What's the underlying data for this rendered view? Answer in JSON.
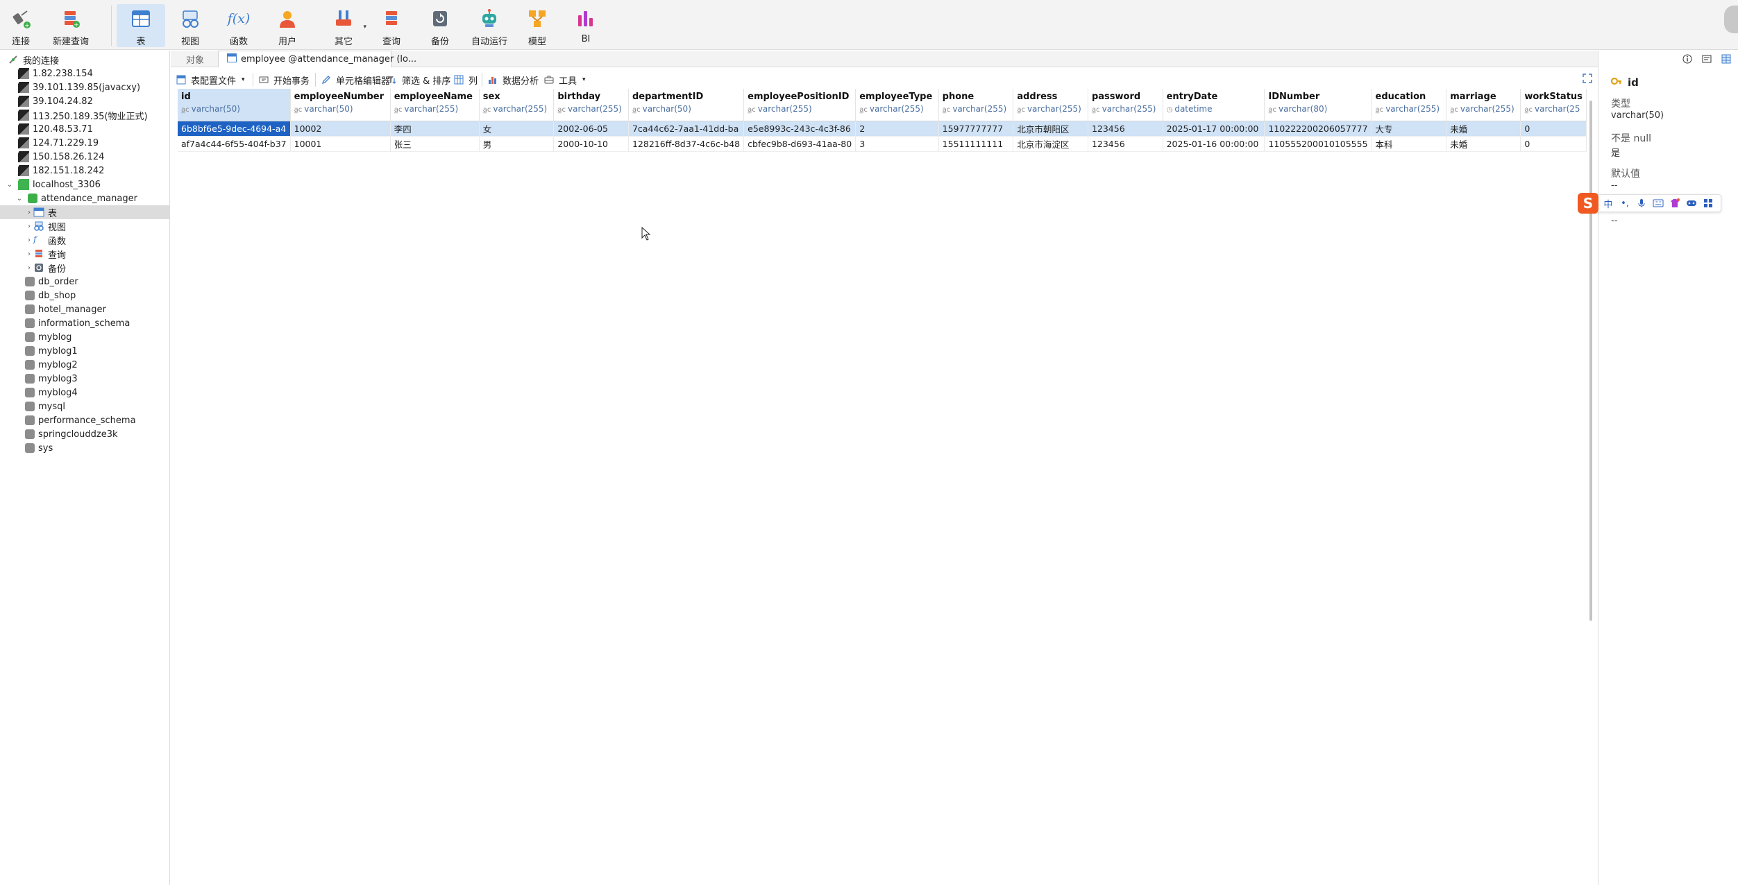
{
  "toolbar": {
    "buttons": [
      {
        "label": "连接",
        "icon": "plug-icon"
      },
      {
        "label": "新建查询",
        "icon": "new-query-icon"
      },
      {
        "label": "表",
        "icon": "table-icon"
      },
      {
        "label": "视图",
        "icon": "view-icon"
      },
      {
        "label": "函数",
        "icon": "function-icon"
      },
      {
        "label": "用户",
        "icon": "user-icon"
      },
      {
        "label": "其它",
        "icon": "tools-icon"
      },
      {
        "label": "查询",
        "icon": "query-icon"
      },
      {
        "label": "备份",
        "icon": "backup-icon"
      },
      {
        "label": "自动运行",
        "icon": "robot-icon"
      },
      {
        "label": "模型",
        "icon": "model-icon"
      },
      {
        "label": "BI",
        "icon": "bi-icon"
      }
    ],
    "function_glyph": "f(x)"
  },
  "nav": {
    "root": "我的连接",
    "connections": [
      "1.82.238.154",
      "39.101.139.85(javacxy)",
      "39.104.24.82",
      "113.250.189.35(物业正式)",
      "120.48.53.71",
      "124.71.229.19",
      "150.158.26.124",
      "182.151.18.242"
    ],
    "localhost": "localhost_3306",
    "active_db": "attendance_manager",
    "db_children": [
      "表",
      "视图",
      "函数",
      "查询",
      "备份"
    ],
    "databases": [
      "db_order",
      "db_shop",
      "hotel_manager",
      "information_schema",
      "myblog",
      "myblog1",
      "myblog2",
      "myblog3",
      "myblog4",
      "mysql",
      "performance_schema",
      "springclouddze3k",
      "sys"
    ]
  },
  "tabs": {
    "objects": "对象",
    "active": "employee @attendance_manager (lo..."
  },
  "subbar": {
    "profile": "表配置文件",
    "begin_tx": "开始事务",
    "cell_editor": "单元格编辑器",
    "filter_sort": "筛选 & 排序",
    "columns": "列",
    "analysis": "数据分析",
    "tools": "工具"
  },
  "grid": {
    "type_glyph": "a̲c",
    "columns": [
      {
        "name": "id",
        "type": "varchar(50)"
      },
      {
        "name": "employeeNumber",
        "type": "varchar(50)"
      },
      {
        "name": "employeeName",
        "type": "varchar(255)"
      },
      {
        "name": "sex",
        "type": "varchar(255)"
      },
      {
        "name": "birthday",
        "type": "varchar(255)"
      },
      {
        "name": "departmentID",
        "type": "varchar(50)"
      },
      {
        "name": "employeePositionID",
        "type": "varchar(255)"
      },
      {
        "name": "employeeType",
        "type": "varchar(255)"
      },
      {
        "name": "phone",
        "type": "varchar(255)"
      },
      {
        "name": "address",
        "type": "varchar(255)"
      },
      {
        "name": "password",
        "type": "varchar(255)"
      },
      {
        "name": "entryDate",
        "type": "datetime"
      },
      {
        "name": "IDNumber",
        "type": "varchar(80)"
      },
      {
        "name": "education",
        "type": "varchar(255)"
      },
      {
        "name": "marriage",
        "type": "varchar(255)"
      },
      {
        "name": "workStatus",
        "type": "varchar(25"
      }
    ],
    "rows": [
      [
        "6b8bf6e5-9dec-4694-a4",
        "10002",
        "李四",
        "女",
        "2002-06-05",
        "7ca44c62-7aa1-41dd-ba",
        "e5e8993c-243c-4c3f-86",
        "2",
        "15977777777",
        "北京市朝阳区",
        "123456",
        "2025-01-17 00:00:00",
        "110222200206057777",
        "大专",
        "未婚",
        "0"
      ],
      [
        "af7a4c44-6f55-404f-b37",
        "10001",
        "张三",
        "男",
        "2000-10-10",
        "128216ff-8d37-4c6c-b48",
        "cbfec9b8-d693-41aa-80",
        "3",
        "15511111111",
        "北京市海淀区",
        "123456",
        "2025-01-16 00:00:00",
        "110555200010105555",
        "本科",
        "未婚",
        "0"
      ]
    ]
  },
  "rpanel": {
    "field": "id",
    "type_label": "类型",
    "type_value": "varchar(50)",
    "notnull_label": "不是 null",
    "notnull_value": "是",
    "default_label": "默认值",
    "default_value": "--",
    "comment_value": "--"
  },
  "ime": {
    "logo": "S",
    "mode": "中",
    "punct": "•,"
  }
}
